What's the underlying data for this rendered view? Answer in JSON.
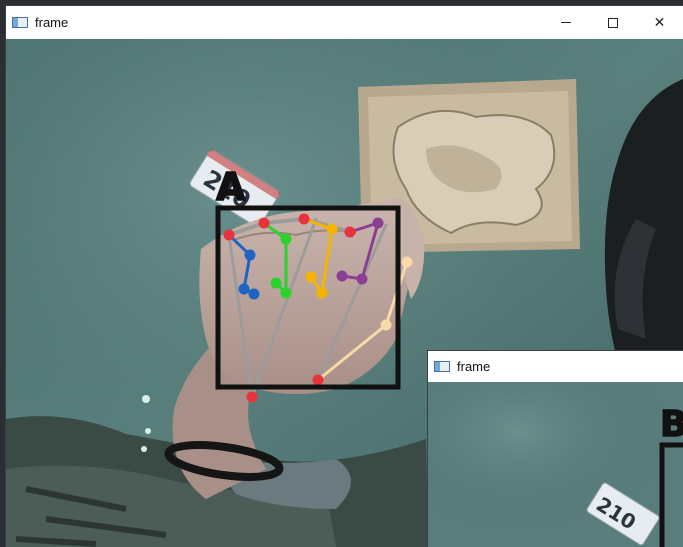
{
  "windows": [
    {
      "title": "frame",
      "controls": {
        "minimize": "minimize",
        "maximize": "maximize",
        "close": "✕"
      },
      "detection_label": "A"
    },
    {
      "title": "frame",
      "detection_label": "B"
    }
  ],
  "scene": {
    "license_plate_text": "210",
    "skeleton_colors": {
      "thumb": "#f8d9a8",
      "index": "#1f63c4",
      "middle": "#2bd22b",
      "ring": "#f5b400",
      "pinky": "#8b3f93",
      "palm": "#e8323c",
      "box": "#111111"
    }
  }
}
